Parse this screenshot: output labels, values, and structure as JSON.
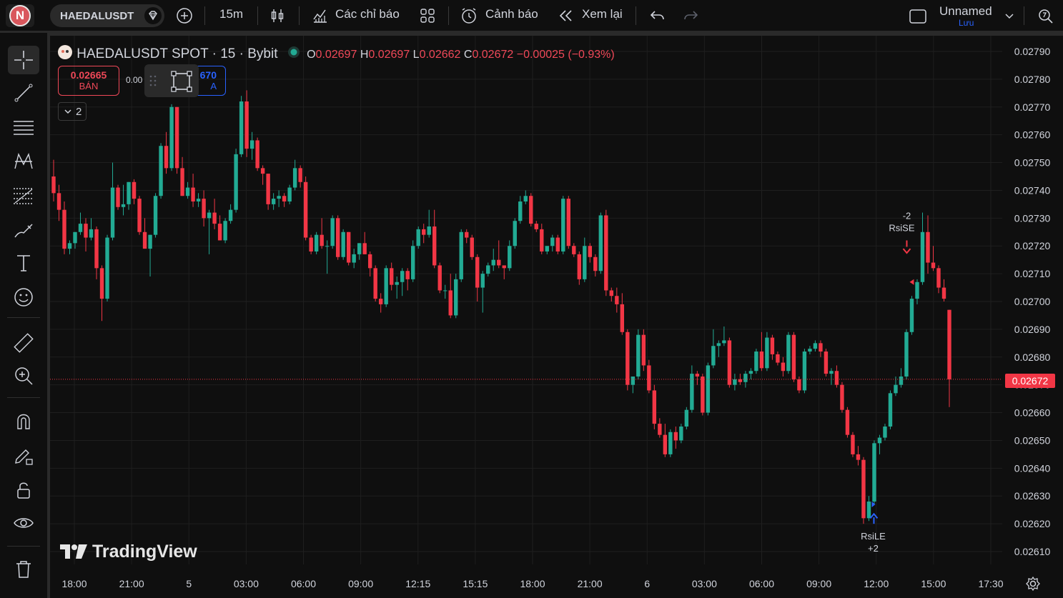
{
  "header": {
    "avatar_letter": "N",
    "symbol": "HAEDALUSDT",
    "interval": "15m",
    "indicators_label": "Các chỉ báo",
    "alerts_label": "Cảnh báo",
    "replay_label": "Xem lại",
    "layout_name": "Unnamed",
    "save_label": "Lưu"
  },
  "legend": {
    "title": "HAEDALUSDT SPOT · 15 · Bybit",
    "o_label": "O",
    "o_value": "0.02697",
    "h_label": "H",
    "h_value": "0.02697",
    "l_label": "L",
    "l_value": "0.02662",
    "c_label": "C",
    "c_value": "0.02672",
    "change": "−0.00025 (−0.93%)"
  },
  "trade": {
    "sell_price": "0.02665",
    "sell_label": "BÁN",
    "spread": "0.00",
    "buy_price": "670",
    "buy_label": "A"
  },
  "indicators_collapsed_count": "2",
  "watermark": "TradingView",
  "last_price": "0.02672",
  "colors": {
    "up": "#22ab94",
    "down": "#f23645",
    "background": "#0f0f0f",
    "grid": "#1f1f1f",
    "signal_long": "#2962ff"
  },
  "chart_data": {
    "type": "candlestick",
    "y_axis_ticks": [
      "0.02790",
      "0.02780",
      "0.02770",
      "0.02760",
      "0.02750",
      "0.02740",
      "0.02730",
      "0.02720",
      "0.02710",
      "0.02700",
      "0.02690",
      "0.02680",
      "0.02670",
      "0.02660",
      "0.02650",
      "0.02640",
      "0.02630",
      "0.02620",
      "0.02610"
    ],
    "x_axis_ticks": [
      "18:00",
      "21:00",
      "5",
      "03:00",
      "06:00",
      "09:00",
      "12:15",
      "15:15",
      "18:00",
      "21:00",
      "6",
      "03:00",
      "06:00",
      "09:00",
      "12:00",
      "15:00",
      "17:30"
    ],
    "ylim": [
      0.02605,
      0.02795
    ],
    "signals": [
      {
        "label": "RsiSE",
        "count": "-2"
      },
      {
        "label": "RsiLE",
        "count": "+2"
      }
    ],
    "ohlc": [
      [
        0.02745,
        0.02751,
        0.02736,
        0.02739
      ],
      [
        0.02739,
        0.02742,
        0.02729,
        0.02733
      ],
      [
        0.02733,
        0.02736,
        0.02717,
        0.02719
      ],
      [
        0.02719,
        0.02722,
        0.02717,
        0.02721
      ],
      [
        0.02721,
        0.02725,
        0.02719,
        0.02725
      ],
      [
        0.02725,
        0.02732,
        0.02724,
        0.02728
      ],
      [
        0.02728,
        0.0273,
        0.02718,
        0.02723
      ],
      [
        0.02723,
        0.0273,
        0.02722,
        0.02726
      ],
      [
        0.02726,
        0.02727,
        0.02708,
        0.02712
      ],
      [
        0.02712,
        0.02713,
        0.02693,
        0.02701
      ],
      [
        0.02701,
        0.02724,
        0.027,
        0.02723
      ],
      [
        0.02723,
        0.0275,
        0.02722,
        0.02741
      ],
      [
        0.02741,
        0.02742,
        0.02733,
        0.02734
      ],
      [
        0.02734,
        0.02742,
        0.02731,
        0.02735
      ],
      [
        0.02735,
        0.02743,
        0.02733,
        0.02743
      ],
      [
        0.02743,
        0.02744,
        0.02735,
        0.02737
      ],
      [
        0.02737,
        0.02738,
        0.02724,
        0.02725
      ],
      [
        0.02725,
        0.0273,
        0.02719,
        0.02719
      ],
      [
        0.02719,
        0.02724,
        0.02709,
        0.02724
      ],
      [
        0.02724,
        0.02739,
        0.02723,
        0.02738
      ],
      [
        0.02738,
        0.02757,
        0.02737,
        0.02756
      ],
      [
        0.02756,
        0.02761,
        0.02746,
        0.02748
      ],
      [
        0.02748,
        0.02771,
        0.02747,
        0.0277
      ],
      [
        0.0277,
        0.0277,
        0.02746,
        0.02748
      ],
      [
        0.02748,
        0.02752,
        0.02738,
        0.02738
      ],
      [
        0.02738,
        0.02743,
        0.02737,
        0.02741
      ],
      [
        0.02741,
        0.02746,
        0.02734,
        0.02736
      ],
      [
        0.02736,
        0.02739,
        0.02734,
        0.02737
      ],
      [
        0.02737,
        0.0274,
        0.02727,
        0.0273
      ],
      [
        0.0273,
        0.02733,
        0.02717,
        0.02732
      ],
      [
        0.02732,
        0.02737,
        0.02726,
        0.02728
      ],
      [
        0.02728,
        0.02731,
        0.02722,
        0.02722
      ],
      [
        0.02722,
        0.0273,
        0.02721,
        0.02729
      ],
      [
        0.02729,
        0.02735,
        0.02728,
        0.02733
      ],
      [
        0.02733,
        0.02755,
        0.02732,
        0.02753
      ],
      [
        0.02753,
        0.02774,
        0.02752,
        0.02772
      ],
      [
        0.02772,
        0.02776,
        0.02752,
        0.02755
      ],
      [
        0.02755,
        0.02761,
        0.02751,
        0.02758
      ],
      [
        0.02758,
        0.02759,
        0.02747,
        0.02748
      ],
      [
        0.02748,
        0.02749,
        0.02742,
        0.02746
      ],
      [
        0.02746,
        0.02746,
        0.02733,
        0.02735
      ],
      [
        0.02735,
        0.02739,
        0.02733,
        0.02737
      ],
      [
        0.02737,
        0.0274,
        0.02734,
        0.02738
      ],
      [
        0.02738,
        0.02739,
        0.02734,
        0.02736
      ],
      [
        0.02736,
        0.02742,
        0.02735,
        0.02741
      ],
      [
        0.02741,
        0.02751,
        0.0274,
        0.02748
      ],
      [
        0.02748,
        0.02749,
        0.02741,
        0.02743
      ],
      [
        0.02743,
        0.02745,
        0.02722,
        0.02723
      ],
      [
        0.02723,
        0.02724,
        0.02717,
        0.02718
      ],
      [
        0.02718,
        0.02725,
        0.02717,
        0.02724
      ],
      [
        0.02724,
        0.0273,
        0.02719,
        0.0272
      ],
      [
        0.0272,
        0.02722,
        0.0271,
        0.0272
      ],
      [
        0.0272,
        0.02731,
        0.02719,
        0.0273
      ],
      [
        0.0273,
        0.02731,
        0.02715,
        0.02716
      ],
      [
        0.02716,
        0.02726,
        0.02715,
        0.02725
      ],
      [
        0.02725,
        0.02725,
        0.02713,
        0.02714
      ],
      [
        0.02714,
        0.02719,
        0.02712,
        0.02717
      ],
      [
        0.02717,
        0.02721,
        0.02715,
        0.02721
      ],
      [
        0.02721,
        0.02725,
        0.02717,
        0.02717
      ],
      [
        0.02717,
        0.02718,
        0.02709,
        0.02712
      ],
      [
        0.02712,
        0.02713,
        0.027,
        0.02701
      ],
      [
        0.02701,
        0.02703,
        0.02696,
        0.02699
      ],
      [
        0.02699,
        0.02713,
        0.02698,
        0.02712
      ],
      [
        0.02712,
        0.02714,
        0.02704,
        0.02706
      ],
      [
        0.02706,
        0.02709,
        0.02701,
        0.02707
      ],
      [
        0.02707,
        0.02712,
        0.02702,
        0.02711
      ],
      [
        0.02711,
        0.02712,
        0.02704,
        0.02708
      ],
      [
        0.02708,
        0.02722,
        0.02707,
        0.0272
      ],
      [
        0.0272,
        0.02727,
        0.02719,
        0.02726
      ],
      [
        0.02726,
        0.02728,
        0.02721,
        0.02724
      ],
      [
        0.02724,
        0.02733,
        0.02723,
        0.02727
      ],
      [
        0.02727,
        0.02733,
        0.02712,
        0.02713
      ],
      [
        0.02713,
        0.02714,
        0.02703,
        0.02704
      ],
      [
        0.02704,
        0.02706,
        0.02701,
        0.02704
      ],
      [
        0.02704,
        0.0271,
        0.02694,
        0.02695
      ],
      [
        0.02695,
        0.0271,
        0.02694,
        0.02708
      ],
      [
        0.02708,
        0.02726,
        0.02707,
        0.02725
      ],
      [
        0.02725,
        0.02726,
        0.02721,
        0.02723
      ],
      [
        0.02723,
        0.02724,
        0.02715,
        0.02716
      ],
      [
        0.02716,
        0.02717,
        0.027,
        0.02705
      ],
      [
        0.02705,
        0.02711,
        0.02696,
        0.0271
      ],
      [
        0.0271,
        0.02714,
        0.02709,
        0.02713
      ],
      [
        0.02713,
        0.02719,
        0.02711,
        0.02715
      ],
      [
        0.02715,
        0.02722,
        0.02712,
        0.02713
      ],
      [
        0.02713,
        0.02713,
        0.02708,
        0.02712
      ],
      [
        0.02712,
        0.02722,
        0.02711,
        0.0272
      ],
      [
        0.0272,
        0.0273,
        0.02719,
        0.02729
      ],
      [
        0.02729,
        0.02738,
        0.02728,
        0.02736
      ],
      [
        0.02736,
        0.0274,
        0.02735,
        0.02738
      ],
      [
        0.02738,
        0.02739,
        0.02727,
        0.02728
      ],
      [
        0.02728,
        0.02729,
        0.02725,
        0.02726
      ],
      [
        0.02726,
        0.02728,
        0.02717,
        0.02718
      ],
      [
        0.02718,
        0.02719,
        0.02717,
        0.0272
      ],
      [
        0.0272,
        0.02724,
        0.02718,
        0.02723
      ],
      [
        0.02723,
        0.02724,
        0.02717,
        0.02718
      ],
      [
        0.02718,
        0.02738,
        0.02717,
        0.02737
      ],
      [
        0.02737,
        0.02738,
        0.02719,
        0.0272
      ],
      [
        0.0272,
        0.02721,
        0.02716,
        0.02717
      ],
      [
        0.02717,
        0.02718,
        0.02706,
        0.02708
      ],
      [
        0.02708,
        0.02723,
        0.02707,
        0.0272
      ],
      [
        0.0272,
        0.02721,
        0.02714,
        0.02716
      ],
      [
        0.02716,
        0.02717,
        0.02709,
        0.02711
      ],
      [
        0.02711,
        0.02732,
        0.0271,
        0.02731
      ],
      [
        0.02731,
        0.02733,
        0.02702,
        0.02704
      ],
      [
        0.02704,
        0.02705,
        0.027,
        0.02702
      ],
      [
        0.02702,
        0.02705,
        0.02696,
        0.02699
      ],
      [
        0.02699,
        0.02703,
        0.02688,
        0.02689
      ],
      [
        0.02689,
        0.0269,
        0.02668,
        0.0267
      ],
      [
        0.0267,
        0.02672,
        0.02667,
        0.02673
      ],
      [
        0.02673,
        0.0269,
        0.02672,
        0.02688
      ],
      [
        0.02688,
        0.0269,
        0.02675,
        0.02677
      ],
      [
        0.02677,
        0.02679,
        0.02667,
        0.02668
      ],
      [
        0.02668,
        0.0267,
        0.02654,
        0.02656
      ],
      [
        0.02656,
        0.02658,
        0.02651,
        0.02652
      ],
      [
        0.02652,
        0.02656,
        0.02644,
        0.02645
      ],
      [
        0.02645,
        0.02654,
        0.02644,
        0.02653
      ],
      [
        0.02653,
        0.02655,
        0.02647,
        0.0265
      ],
      [
        0.0265,
        0.02656,
        0.02649,
        0.02655
      ],
      [
        0.02655,
        0.02662,
        0.02654,
        0.02661
      ],
      [
        0.02661,
        0.02677,
        0.0266,
        0.02674
      ],
      [
        0.02674,
        0.02675,
        0.0267,
        0.02673
      ],
      [
        0.02673,
        0.02674,
        0.02659,
        0.0266
      ],
      [
        0.0266,
        0.02678,
        0.02659,
        0.02677
      ],
      [
        0.02677,
        0.0269,
        0.02676,
        0.02684
      ],
      [
        0.02684,
        0.02686,
        0.0268,
        0.02685
      ],
      [
        0.02685,
        0.02691,
        0.02684,
        0.02686
      ],
      [
        0.02686,
        0.02687,
        0.02669,
        0.0267
      ],
      [
        0.0267,
        0.02674,
        0.02668,
        0.02672
      ],
      [
        0.02672,
        0.02674,
        0.0267,
        0.02671
      ],
      [
        0.02671,
        0.02675,
        0.02669,
        0.02674
      ],
      [
        0.02674,
        0.02676,
        0.02672,
        0.02675
      ],
      [
        0.02675,
        0.02683,
        0.02674,
        0.02682
      ],
      [
        0.02682,
        0.02689,
        0.02675,
        0.02676
      ],
      [
        0.02676,
        0.02689,
        0.02675,
        0.02687
      ],
      [
        0.02687,
        0.02688,
        0.02679,
        0.02681
      ],
      [
        0.02681,
        0.02682,
        0.02677,
        0.02678
      ],
      [
        0.02678,
        0.0268,
        0.02673,
        0.02675
      ],
      [
        0.02675,
        0.02689,
        0.02674,
        0.02688
      ],
      [
        0.02688,
        0.02689,
        0.02671,
        0.02672
      ],
      [
        0.02672,
        0.02673,
        0.02667,
        0.02668
      ],
      [
        0.02668,
        0.02683,
        0.02667,
        0.02682
      ],
      [
        0.02682,
        0.02684,
        0.02681,
        0.02683
      ],
      [
        0.02683,
        0.02686,
        0.02682,
        0.02685
      ],
      [
        0.02685,
        0.02686,
        0.0268,
        0.02682
      ],
      [
        0.02682,
        0.02683,
        0.02673,
        0.02674
      ],
      [
        0.02674,
        0.02676,
        0.0267,
        0.02675
      ],
      [
        0.02675,
        0.02677,
        0.02669,
        0.0267
      ],
      [
        0.0267,
        0.02671,
        0.0266,
        0.02661
      ],
      [
        0.02661,
        0.02662,
        0.02651,
        0.02652
      ],
      [
        0.02652,
        0.02653,
        0.02644,
        0.02645
      ],
      [
        0.02645,
        0.02648,
        0.02641,
        0.02643
      ],
      [
        0.02643,
        0.02644,
        0.0262,
        0.02622
      ],
      [
        0.02622,
        0.0263,
        0.02621,
        0.02628
      ],
      [
        0.02628,
        0.0265,
        0.02627,
        0.02649
      ],
      [
        0.02649,
        0.02652,
        0.02645,
        0.02651
      ],
      [
        0.02651,
        0.02656,
        0.0265,
        0.02655
      ],
      [
        0.02655,
        0.02668,
        0.02654,
        0.02667
      ],
      [
        0.02667,
        0.02673,
        0.02666,
        0.0267
      ],
      [
        0.0267,
        0.02676,
        0.02669,
        0.02673
      ],
      [
        0.02673,
        0.0269,
        0.02672,
        0.02689
      ],
      [
        0.02689,
        0.02702,
        0.02688,
        0.02701
      ],
      [
        0.02701,
        0.02708,
        0.02699,
        0.02707
      ],
      [
        0.02707,
        0.02732,
        0.02706,
        0.02725
      ],
      [
        0.02725,
        0.02731,
        0.0271,
        0.02714
      ],
      [
        0.02714,
        0.0272,
        0.02711,
        0.02712
      ],
      [
        0.02712,
        0.02713,
        0.02703,
        0.02705
      ],
      [
        0.02705,
        0.02708,
        0.027,
        0.02701
      ],
      [
        0.02697,
        0.02697,
        0.02662,
        0.02672
      ]
    ]
  }
}
